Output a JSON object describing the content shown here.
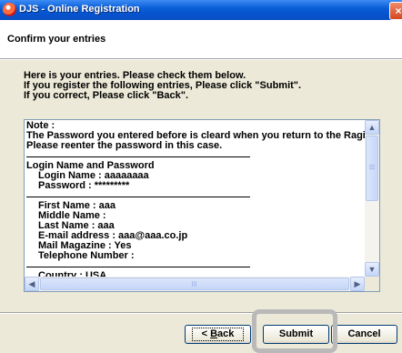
{
  "window": {
    "title": "DJS - Online Registration",
    "close_glyph": "×"
  },
  "header": {
    "title": "Confirm your entries"
  },
  "instructions": [
    "Here is your entries. Please check them below.",
    "If you register the following entries, Please click \"Submit\".",
    "If you correct, Please click \"Back\"."
  ],
  "entries": {
    "note_label": "Note :",
    "note_lines": [
      "The Password you entered before is cleard when you return to the Ragistration Form.",
      "Please reenter the password in this case."
    ],
    "login_section_title": "Login Name and Password",
    "login_name": "Login Name : aaaaaaaa",
    "password": "Password : *********",
    "first_name": "First Name : aaa",
    "middle_name": "Middle Name :",
    "last_name": "Last Name : aaa",
    "email": "E-mail address : aaa@aaa.co.jp",
    "mail_magazine": "Mail Magazine : Yes",
    "telephone": "Telephone Number :",
    "country": "Country : USA"
  },
  "scrollbar_glyphs": {
    "up": "▲",
    "down": "▼",
    "left": "◀",
    "right": "▶"
  },
  "buttons": {
    "back_prefix": "< ",
    "back_mnemonic": "B",
    "back_rest": "ack",
    "submit": "Submit",
    "cancel": "Cancel"
  }
}
